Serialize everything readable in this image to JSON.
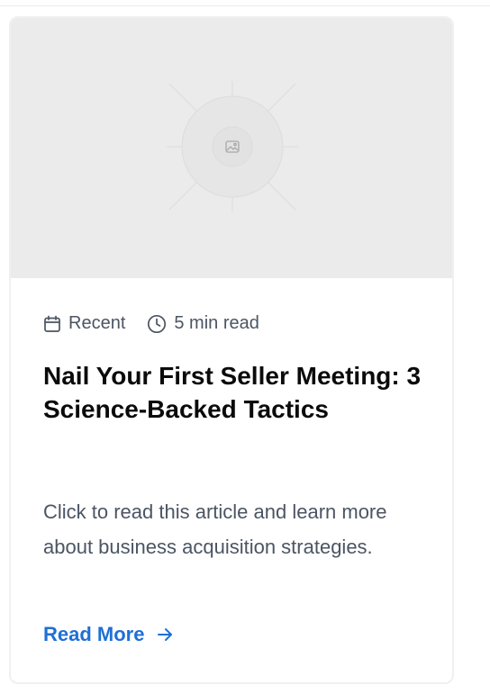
{
  "article_card": {
    "image_alt_icon": "image-placeholder-icon",
    "meta": {
      "date_label": "Recent",
      "read_time": "5 min read",
      "date_icon": "calendar-icon",
      "time_icon": "clock-icon"
    },
    "title": "Nail Your First Seller Meeting: 3 Science-Backed Tactics",
    "excerpt": "Click to read this article and learn more about business acquisition strategies.",
    "cta": {
      "label": "Read More",
      "icon": "arrow-right-icon"
    }
  },
  "colors": {
    "accent": "#1f6fd6",
    "title": "#0b0b0b",
    "body_text": "#4b5563",
    "image_bg": "#ebebeb",
    "card_border": "#f0f0f0"
  }
}
